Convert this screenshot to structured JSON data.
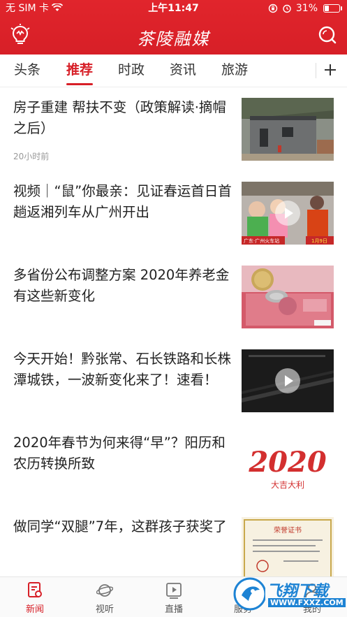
{
  "status": {
    "carrier": "无 SIM 卡",
    "time": "上午11:47",
    "battery": "31%",
    "battery_level": 0.31
  },
  "header": {
    "app_title": "茶陵融媒"
  },
  "tabs": [
    {
      "label": "头条"
    },
    {
      "label": "推荐"
    },
    {
      "label": "时政"
    },
    {
      "label": "资讯"
    },
    {
      "label": "旅游"
    }
  ],
  "active_tab": "推荐",
  "news": [
    {
      "title": "房子重建 帮扶不变（政策解读·摘帽之后）",
      "time": "20小时前",
      "video": false
    },
    {
      "title": "视频｜“鼠”你最亲：见证春运首日首趟返湘列车从广州开出",
      "time": "",
      "video": true,
      "thumb_caption": "广东·广州火车站",
      "thumb_date": "1月9日"
    },
    {
      "title": "多省份公布调整方案 2020年养老金有这些新变化",
      "time": "",
      "video": false
    },
    {
      "title": "今天开始！黔张常、石长铁路和长株潭城铁，一波新变化来了！速看！",
      "time": "",
      "video": true
    },
    {
      "title": "2020年春节为何来得“早”？阳历和农历转换所致",
      "time": "",
      "video": false,
      "thumb_text": "2020",
      "thumb_sub": "大吉大利"
    },
    {
      "title": "做同学“双腿”7年，这群孩子获奖了",
      "time": "",
      "video": false,
      "thumb_text": "荣誉证书"
    }
  ],
  "bottom_nav": [
    {
      "label": "新闻"
    },
    {
      "label": "视听"
    },
    {
      "label": "直播"
    },
    {
      "label": "服务"
    },
    {
      "label": "我的"
    }
  ],
  "watermark": {
    "text": "飞翔下载",
    "sub": "WWW.FXXZ.COM"
  },
  "colors": {
    "brand_red": "#d71f27",
    "text": "#222222",
    "muted": "#999999"
  }
}
